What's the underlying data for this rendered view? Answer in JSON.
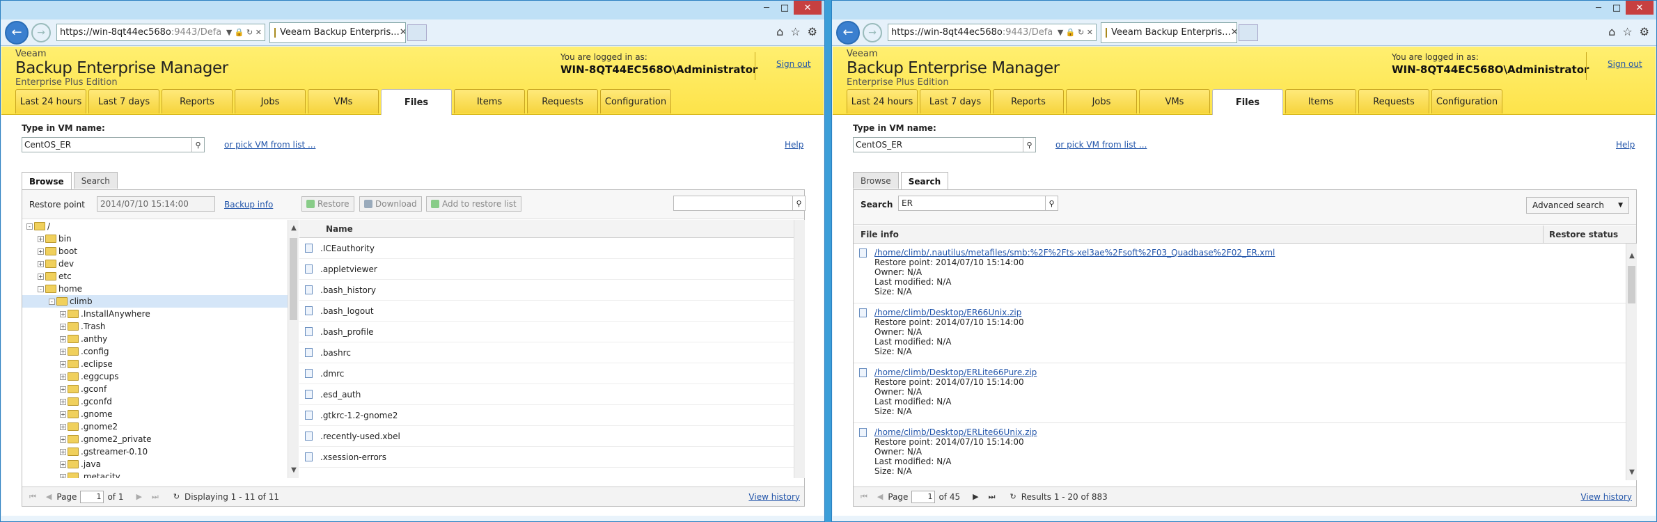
{
  "browser": {
    "url_prefix": "https://win-8qt44ec568o",
    "url_suffix": ":9443/Defa",
    "tab_title": "Veeam Backup Enterpris..."
  },
  "app": {
    "brand_small": "Veeam",
    "product": "Backup Enterprise Manager",
    "edition": "Enterprise Plus Edition",
    "logged_in_label": "You are logged in as:",
    "user": "WIN-8QT44EC568O\\Administrator",
    "sign_out": "Sign out",
    "nav": [
      "Last 24 hours",
      "Last 7 days",
      "Reports",
      "Jobs",
      "VMs",
      "Files",
      "Items",
      "Requests",
      "Configuration"
    ],
    "active_nav": "Files"
  },
  "common": {
    "vm_label": "Type in VM name:",
    "vm_value": "CentOS_ER",
    "pick_link": "or pick VM from list ...",
    "help": "Help",
    "browse_tab": "Browse",
    "search_tab": "Search",
    "view_history": "View history",
    "page_label": "Page"
  },
  "left": {
    "restore_point_label": "Restore point",
    "restore_point_value": "2014/07/10 15:14:00",
    "backup_info": "Backup info",
    "btn_restore": "Restore",
    "btn_download": "Download",
    "btn_add": "Add to restore list",
    "tree": [
      {
        "label": "/",
        "depth": 0,
        "exp": "-"
      },
      {
        "label": "bin",
        "depth": 1,
        "exp": "+"
      },
      {
        "label": "boot",
        "depth": 1,
        "exp": "+"
      },
      {
        "label": "dev",
        "depth": 1,
        "exp": "+"
      },
      {
        "label": "etc",
        "depth": 1,
        "exp": "+"
      },
      {
        "label": "home",
        "depth": 1,
        "exp": "-"
      },
      {
        "label": "climb",
        "depth": 2,
        "exp": "-",
        "selected": true
      },
      {
        "label": ".InstallAnywhere",
        "depth": 3,
        "exp": "+"
      },
      {
        "label": ".Trash",
        "depth": 3,
        "exp": "+"
      },
      {
        "label": ".anthy",
        "depth": 3,
        "exp": "+"
      },
      {
        "label": ".config",
        "depth": 3,
        "exp": "+"
      },
      {
        "label": ".eclipse",
        "depth": 3,
        "exp": "+"
      },
      {
        "label": ".eggcups",
        "depth": 3,
        "exp": "+"
      },
      {
        "label": ".gconf",
        "depth": 3,
        "exp": "+"
      },
      {
        "label": ".gconfd",
        "depth": 3,
        "exp": "+"
      },
      {
        "label": ".gnome",
        "depth": 3,
        "exp": "+"
      },
      {
        "label": ".gnome2",
        "depth": 3,
        "exp": "+"
      },
      {
        "label": ".gnome2_private",
        "depth": 3,
        "exp": "+"
      },
      {
        "label": ".gstreamer-0.10",
        "depth": 3,
        "exp": "+"
      },
      {
        "label": ".java",
        "depth": 3,
        "exp": "+"
      },
      {
        "label": ".metacity",
        "depth": 3,
        "exp": "+"
      }
    ],
    "name_header": "Name",
    "files": [
      ".ICEauthority",
      ".appletviewer",
      ".bash_history",
      ".bash_logout",
      ".bash_profile",
      ".bashrc",
      ".dmrc",
      ".esd_auth",
      ".gtkrc-1.2-gnome2",
      ".recently-used.xbel",
      ".xsession-errors"
    ],
    "page_value": "1",
    "page_of": "of 1",
    "display": "Displaying 1 - 11 of 11"
  },
  "right": {
    "search_label": "Search",
    "search_value": "ER",
    "advanced": "Advanced search",
    "col_info": "File info",
    "col_status": "Restore status",
    "results": [
      {
        "path": "/home/climb/.nautilus/metafiles/smb:%2F%2Fts-xel3ae%2Fsoft%2F03_Quadbase%2F02_ER.xml",
        "rp": "Restore point: 2014/07/10 15:14:00",
        "owner": "Owner: N/A",
        "mod": "Last modified: N/A",
        "size": "Size: N/A"
      },
      {
        "path": "/home/climb/Desktop/ER66Unix.zip",
        "rp": "Restore point: 2014/07/10 15:14:00",
        "owner": "Owner: N/A",
        "mod": "Last modified: N/A",
        "size": "Size: N/A"
      },
      {
        "path": "/home/climb/Desktop/ERLite66Pure.zip",
        "rp": "Restore point: 2014/07/10 15:14:00",
        "owner": "Owner: N/A",
        "mod": "Last modified: N/A",
        "size": "Size: N/A"
      },
      {
        "path": "/home/climb/Desktop/ERLite66Unix.zip",
        "rp": "Restore point: 2014/07/10 15:14:00",
        "owner": "Owner: N/A",
        "mod": "Last modified: N/A",
        "size": "Size: N/A"
      }
    ],
    "page_value": "1",
    "page_of": "of 45",
    "display": "Results 1 - 20 of 883"
  }
}
